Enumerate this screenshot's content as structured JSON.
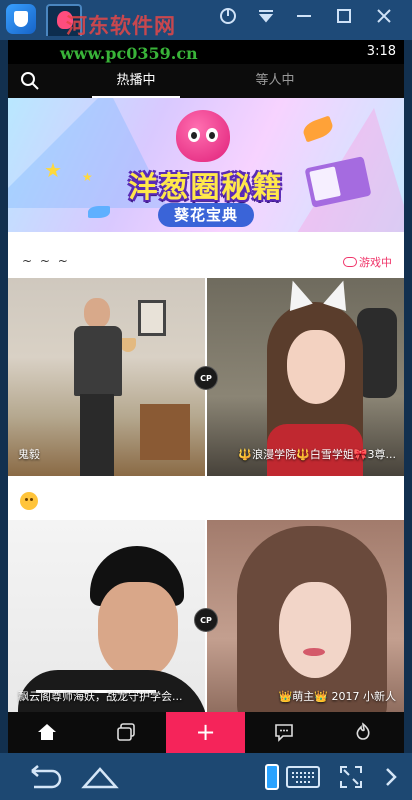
{
  "emulator": {
    "watermark_title": "河东软件网",
    "watermark_url": "www.pc0359.cn",
    "window_controls": [
      "minimize-icon",
      "menu-icon",
      "maximize-icon",
      "close-icon"
    ]
  },
  "status_bar": {
    "time": "3:18"
  },
  "top_nav": {
    "tabs": [
      {
        "label": "热播中",
        "active": true
      },
      {
        "label": "等人中",
        "active": false
      }
    ]
  },
  "banner": {
    "title": "洋葱圈秘籍",
    "subtitle": "葵花宝典"
  },
  "sections": [
    {
      "label": "~ ~ ~",
      "badge": "游戏中",
      "cards": [
        {
          "name": "鬼毅",
          "badge": "CP"
        },
        {
          "name": "🔱浪漫学院🔱白雪学姐🎀3尊..."
        }
      ]
    },
    {
      "label": "",
      "icon": "emoji-icon",
      "cards": [
        {
          "name": "飘云阁尊师海妖，战龙守护学会...",
          "badge": "CP"
        },
        {
          "name": "👑萌主👑 2017 小新人"
        }
      ]
    }
  ],
  "bottom_nav": {
    "items": [
      "home-icon",
      "rooms-icon",
      "plus-icon",
      "chat-icon",
      "discover-icon"
    ],
    "accent": "#f5245a"
  },
  "system_nav": {
    "items": [
      "back-icon",
      "home-outline-icon",
      "phone-mode-icon",
      "keyboard-icon",
      "fullscreen-icon",
      "more-arrow-icon"
    ]
  },
  "colors": {
    "accent_pink": "#f0356a",
    "nav_bg": "#0c0c0c",
    "emulator_blue": "#1e4a78"
  }
}
